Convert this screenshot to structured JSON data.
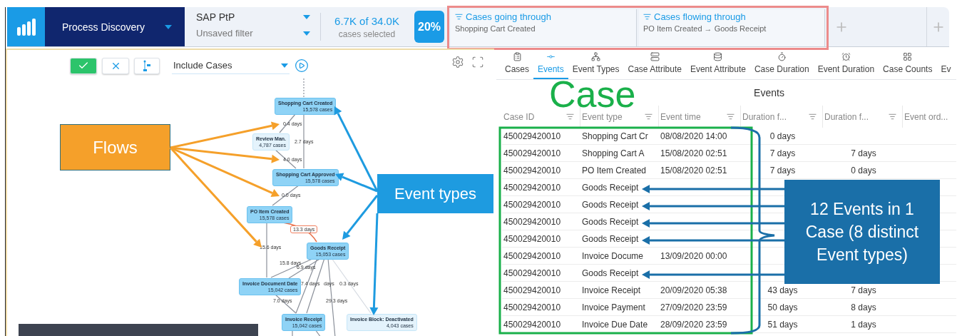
{
  "app_bar": {
    "product": "Process Discovery",
    "dataset": "SAP PtP",
    "filter_name": "Unsaved filter",
    "selection": "6.7K of 34.0K",
    "selection_caption": "cases selected",
    "share": "20%",
    "filters": [
      {
        "title": "Cases going through",
        "detail": "Shopping Cart Created"
      },
      {
        "title": "Cases flowing through",
        "detail": "PO Item Created → Goods Receipt"
      }
    ]
  },
  "map_toolbar": {
    "mode": "Include Cases"
  },
  "process_map": {
    "nodes": [
      {
        "name": "Shopping Cart Created",
        "cases": "15,578 cases",
        "kind": "frequent"
      },
      {
        "name": "Review Man.",
        "cases": "4,787 cases",
        "kind": "rare"
      },
      {
        "name": "Shopping Cart Approved",
        "cases": "15,578 cases",
        "kind": "frequent"
      },
      {
        "name": "PO Item Created",
        "cases": "15,578 cases",
        "kind": "frequent"
      },
      {
        "name": "Goods Receipt",
        "cases": "15,053 cases",
        "kind": "frequent"
      },
      {
        "name": "Invoice Document Date",
        "cases": "15,042 cases",
        "kind": "frequent"
      },
      {
        "name": "Invoice Receipt",
        "cases": "15,042 cases",
        "kind": "frequent"
      },
      {
        "name": "Invoice Block: Deactivated",
        "cases": "4,043 cases",
        "kind": "rare"
      }
    ],
    "edge_labels": [
      {
        "text": "0.4 days",
        "kind": "normal"
      },
      {
        "text": "2.7 days",
        "kind": "normal"
      },
      {
        "text": "4.0 days",
        "kind": "normal"
      },
      {
        "text": "0.0 days",
        "kind": "normal"
      },
      {
        "text": "13.3 days",
        "kind": "bottleneck"
      },
      {
        "text": "15.6 days",
        "kind": "normal"
      },
      {
        "text": "15.8 days",
        "kind": "normal"
      },
      {
        "text": "6.9 days",
        "kind": "normal"
      },
      {
        "text": "7.4 days",
        "kind": "normal"
      },
      {
        "text": "days",
        "kind": "normal"
      },
      {
        "text": "0.3 days",
        "kind": "normal"
      },
      {
        "text": "7.0 days",
        "kind": "normal"
      },
      {
        "text": "29.3 days",
        "kind": "normal"
      }
    ]
  },
  "annotations": {
    "flows": "Flows",
    "event_types": "Event types",
    "case": "Case",
    "summary": "12 Events in 1 Case (8 distinct Event types)"
  },
  "tabs": [
    {
      "label": "Cases",
      "selected": false
    },
    {
      "label": "Events",
      "selected": true
    },
    {
      "label": "Event Types",
      "selected": false
    },
    {
      "label": "Case Attribute",
      "selected": false
    },
    {
      "label": "Event Attribute",
      "selected": false
    },
    {
      "label": "Case Duration",
      "selected": false
    },
    {
      "label": "Event Duration",
      "selected": false
    },
    {
      "label": "Case Counts",
      "selected": false
    },
    {
      "label": "Ev",
      "selected": false
    }
  ],
  "table": {
    "title": "Events",
    "columns": [
      "Case ID",
      "Event type",
      "Event time",
      "Duration f...",
      "Duration f...",
      "Event ord..."
    ],
    "rows": [
      {
        "case_id": "450029420010",
        "event_type": "Shopping Cart Cr",
        "event_time": "08/08/2020 14:00",
        "duration_1": "0 days"
      },
      {
        "case_id": "450029420010",
        "event_type": "Shopping Cart A",
        "event_time": "15/08/2020 02:51",
        "duration_1": "7 days",
        "duration_2": "7 days"
      },
      {
        "case_id": "450029420010",
        "event_type": "PO Item Created",
        "event_time": "15/08/2020 02:51",
        "duration_1": "7 days",
        "duration_2": "0 days"
      },
      {
        "case_id": "450029420010",
        "event_type": "Goods Receipt"
      },
      {
        "case_id": "450029420010",
        "event_type": "Goods Receipt"
      },
      {
        "case_id": "450029420010",
        "event_type": "Goods Receipt"
      },
      {
        "case_id": "450029420010",
        "event_type": "Goods Receipt"
      },
      {
        "case_id": "450029420010",
        "event_type": "Invoice Docume",
        "event_time": "13/09/2020 00:00"
      },
      {
        "case_id": "450029420010",
        "event_type": "Goods Receipt"
      },
      {
        "case_id": "450029420010",
        "event_type": "Invoice Receipt",
        "event_time": "20/09/2020 05:38",
        "duration_1": "43 days",
        "duration_2": "7 days"
      },
      {
        "case_id": "450029420010",
        "event_type": "Invoice Payment",
        "event_time": "27/09/2020 23:59",
        "duration_1": "50 days",
        "duration_2": "8 days"
      },
      {
        "case_id": "450029420010",
        "event_type": "Invoice Due Date",
        "event_time": "28/09/2020 23:59",
        "duration_1": "51 days",
        "duration_2": "1 days"
      }
    ]
  }
}
